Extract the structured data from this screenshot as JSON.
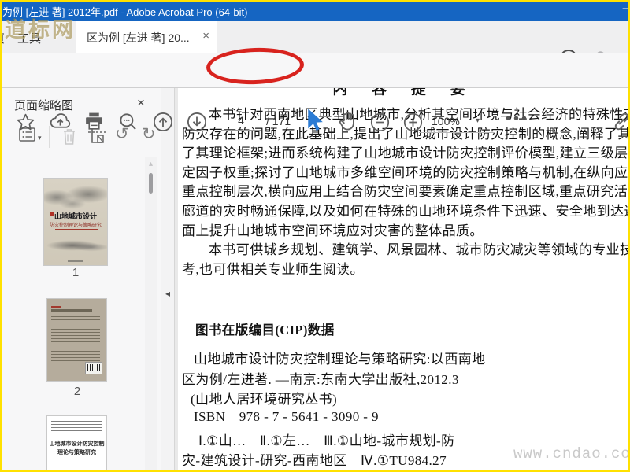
{
  "window": {
    "title": "为例 [左进 著] 2012年.pdf - Adobe Acrobat Pro (64-bit)",
    "minimize_glyph": "–"
  },
  "tabbar": {
    "partial_tab": "页",
    "tools_tab": "工具",
    "doc_tab": "区为例 [左进 著] 20...",
    "doc_tab_close": "×",
    "help_glyph": "?"
  },
  "toolbar": {
    "page_current": "4",
    "page_total_label": "/ 171",
    "zoom_value": "100%",
    "zoom_caret": "▾",
    "more_glyph": "•••"
  },
  "panel": {
    "title": "页面缩略图",
    "close_glyph": "×",
    "options_caret": "▾",
    "rotate_ccw_glyph": "↺",
    "rotate_cw_glyph": "↻",
    "collapse_glyph": "◂",
    "scroll_up_glyph": "▴",
    "thumbnails": [
      {
        "label": "1",
        "cover_title": "山地城市设计",
        "cover_subtitle": "防灾控制理论与策略研究"
      },
      {
        "label": "2"
      },
      {
        "page_title_1": "山地城市设计防灾控制",
        "page_title_2": "理论与策略研究"
      }
    ]
  },
  "document": {
    "heading": "内 容 提 要",
    "para": [
      "本书针对西南地区典型山地城市,分析其空间环境与社会经济的特殊性对城市防灾的影响",
      "防灾存在的问题,在此基础上,提出了山地城市设计防灾控制的概念,阐释了其理论内涵与特征",
      "了其理论框架;进而系统构建了山地城市设计防灾控制评价模型,建立三级层级构架的评价指标",
      "定因子权重;探讨了山地城市多维空间环境的防灾控制策略与机制,在纵向应用上确定以详细规",
      "重点控制层次,横向应用上结合防灾空间要素确定重点控制区域,重点研究活动节点的有效避难",
      "廊道的灾时畅通保障,以及如何在特殊的山地环境条件下迅速、安全地到达避难场所,从而在“宏",
      "面上提升山地城市空间环境应对灾害的整体品质。",
      "本书可供城乡规划、建筑学、风景园林、城市防灾减灾等领域的专业技术人员与政府部门的参",
      "考,也可供相关专业师生阅读。"
    ],
    "cip_title": "图书在版编目(CIP)数据",
    "cip_lines": [
      "山地城市设计防灾控制理论与策略研究:以西南地",
      "区为例/左进著. —南京:东南大学出版社,2012.3",
      "(山地人居环境研究丛书)",
      "ISBN　978 - 7 - 5641 - 3090 - 9",
      "Ⅰ.①山…　Ⅱ.①左…　Ⅲ.①山地-城市规划-防",
      "灾-建筑设计-研究-西南地区　Ⅳ.①TU984.27"
    ]
  },
  "watermarks": {
    "logo": "道标网",
    "site": "www.cndao.com"
  },
  "colors": {
    "titlebar_blue": "#1565c2",
    "annotation_red": "#d8231e",
    "cursor_blue": "#2b7bd4",
    "frame_yellow": "#ffe100"
  }
}
